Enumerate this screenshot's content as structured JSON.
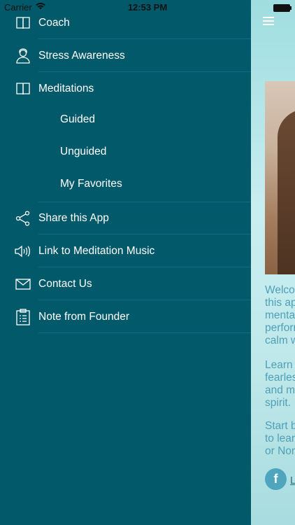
{
  "status_bar": {
    "carrier": "Carrier",
    "time": "12:53 PM"
  },
  "menu": {
    "items": [
      {
        "label": "Coach",
        "icon": "book-icon"
      },
      {
        "label": "Stress Awareness",
        "icon": "head-icon"
      },
      {
        "label": "Meditations",
        "icon": "book-icon"
      },
      {
        "label": "Guided"
      },
      {
        "label": "Unguided"
      },
      {
        "label": "My Favorites"
      },
      {
        "label": "Share this App",
        "icon": "share-icon"
      },
      {
        "label": "Link to Meditation Music",
        "icon": "speaker-icon"
      },
      {
        "label": "Contact Us",
        "icon": "envelope-icon"
      },
      {
        "label": "Note from Founder",
        "icon": "clipboard-icon"
      }
    ]
  },
  "main": {
    "paragraph_1": "Welcor\nthis ap\nmental\nperforn\ncalm w",
    "paragraph_2": "Learn h\nfearles\nand ma\nspirit.",
    "paragraph_3": "Start b\nto learr\nor Non",
    "facebook_link": "L"
  },
  "colors": {
    "drawer_bg": "#02596a",
    "separator": "#0f6e80",
    "main_text": "#4f9fb6"
  }
}
